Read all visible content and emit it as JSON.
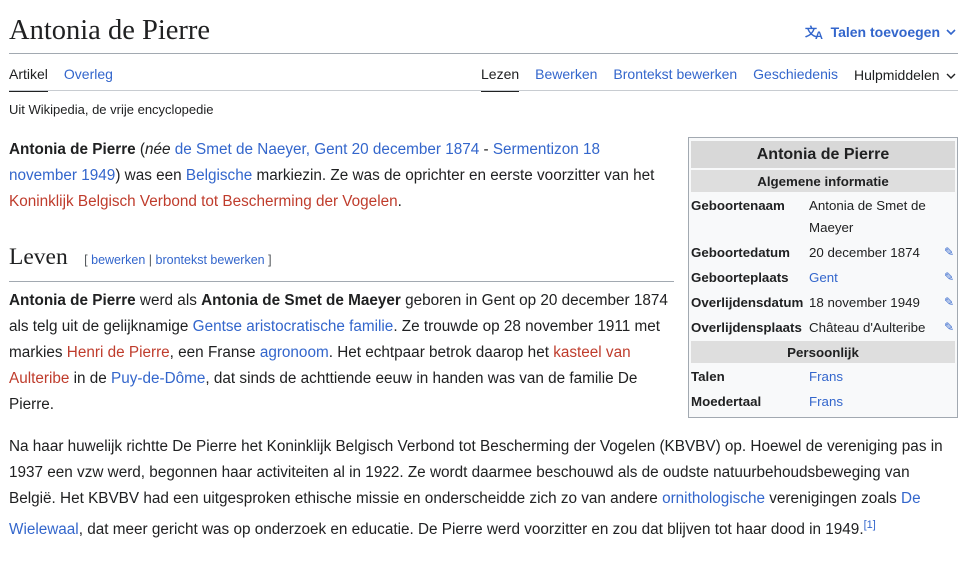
{
  "page": {
    "title": "Antonia de Pierre",
    "add_languages": "Talen toevoegen",
    "tagline": "Uit Wikipedia, de vrije encyclopedie"
  },
  "tabs_left": [
    "Artikel",
    "Overleg"
  ],
  "tabs_right": [
    "Lezen",
    "Bewerken",
    "Brontekst bewerken",
    "Geschiedenis"
  ],
  "tools_label": "Hulpmiddelen",
  "intro": {
    "name": "Antonia de Pierre",
    "open_paren": " (",
    "nee": "née",
    "space1": " ",
    "birth_link": "de Smet de Naeyer, Gent 20 december 1874",
    "dash": " - ",
    "death_link": "Sermentizon 18 november 1949",
    "t1": ") was een ",
    "belgian_link": "Belgische",
    "t2": " markiezin. Ze was de oprichter en eerste voorzitter van het ",
    "org_link": "Koninklijk Belgisch Verbond tot Bescherming der Vogelen",
    "t3": "."
  },
  "section": {
    "title": "Leven",
    "edit_open": "[ ",
    "edit": "bewerken",
    "sep": " | ",
    "edit_source": "brontekst bewerken",
    "edit_close": " ]"
  },
  "leven": {
    "name": "Antonia de Pierre",
    "t1": " werd als ",
    "birthname": "Antonia de Smet de Maeyer",
    "t2": " geboren in Gent op 20 december 1874 als telg uit de gelijknamige ",
    "family_link": "Gentse aristocratische familie",
    "t3": ". Ze trouwde op 28 november 1911 met markies ",
    "henri_link": "Henri de Pierre",
    "t4": ", een Franse ",
    "agronoom_link": "agronoom",
    "t5": ". Het echtpaar betrok daarop het ",
    "kasteel_link": "kasteel van Aulteribe",
    "t6": " in de ",
    "puy_link": "Puy-de-Dôme",
    "t7": ", dat sinds de achttiende eeuw in handen was van de familie De Pierre."
  },
  "para3": {
    "t1": "Na haar huwelijk richtte De Pierre het Koninklijk Belgisch Verbond tot Bescherming der Vogelen (KBVBV) op. Hoewel de vereniging pas in 1937 een vzw werd, begonnen haar activiteiten al in 1922. Ze wordt daarmee beschouwd als de oudste natuurbehoudsbeweging van België. Het KBVBV had een uitgesproken ethische missie en onderscheidde zich zo van andere ",
    "orni_link": "ornithologische",
    "t2": " verenigingen zoals ",
    "wiel_link": "De Wielewaal",
    "t3": ", dat meer gericht was op onderzoek en educatie. De Pierre werd voorzitter en zou dat blijven tot haar dood in 1949.",
    "ref": "[1]"
  },
  "infobox": {
    "title": "Antonia de Pierre",
    "section_general": "Algemene informatie",
    "section_personal": "Persoonlijk",
    "rows": [
      {
        "label": "Geboortenaam",
        "value": "Antonia de Smet de Maeyer"
      },
      {
        "label": "Geboortedatum",
        "value": "20 december 1874"
      },
      {
        "label": "Geboorteplaats",
        "value": "Gent"
      },
      {
        "label": "Overlijdensdatum",
        "value": "18 november 1949"
      },
      {
        "label": "Overlijdensplaats",
        "value": "Château d'Aulteribe"
      }
    ],
    "personal_rows": [
      {
        "label": "Talen",
        "value": "Frans"
      },
      {
        "label": "Moedertaal",
        "value": "Frans"
      }
    ]
  },
  "colors": {
    "link": "#3366cc",
    "redlink": "#bf3c2c",
    "text": "#202122"
  },
  "icons": [
    "translate-icon",
    "chevron-down-icon",
    "pencil-icon"
  ]
}
